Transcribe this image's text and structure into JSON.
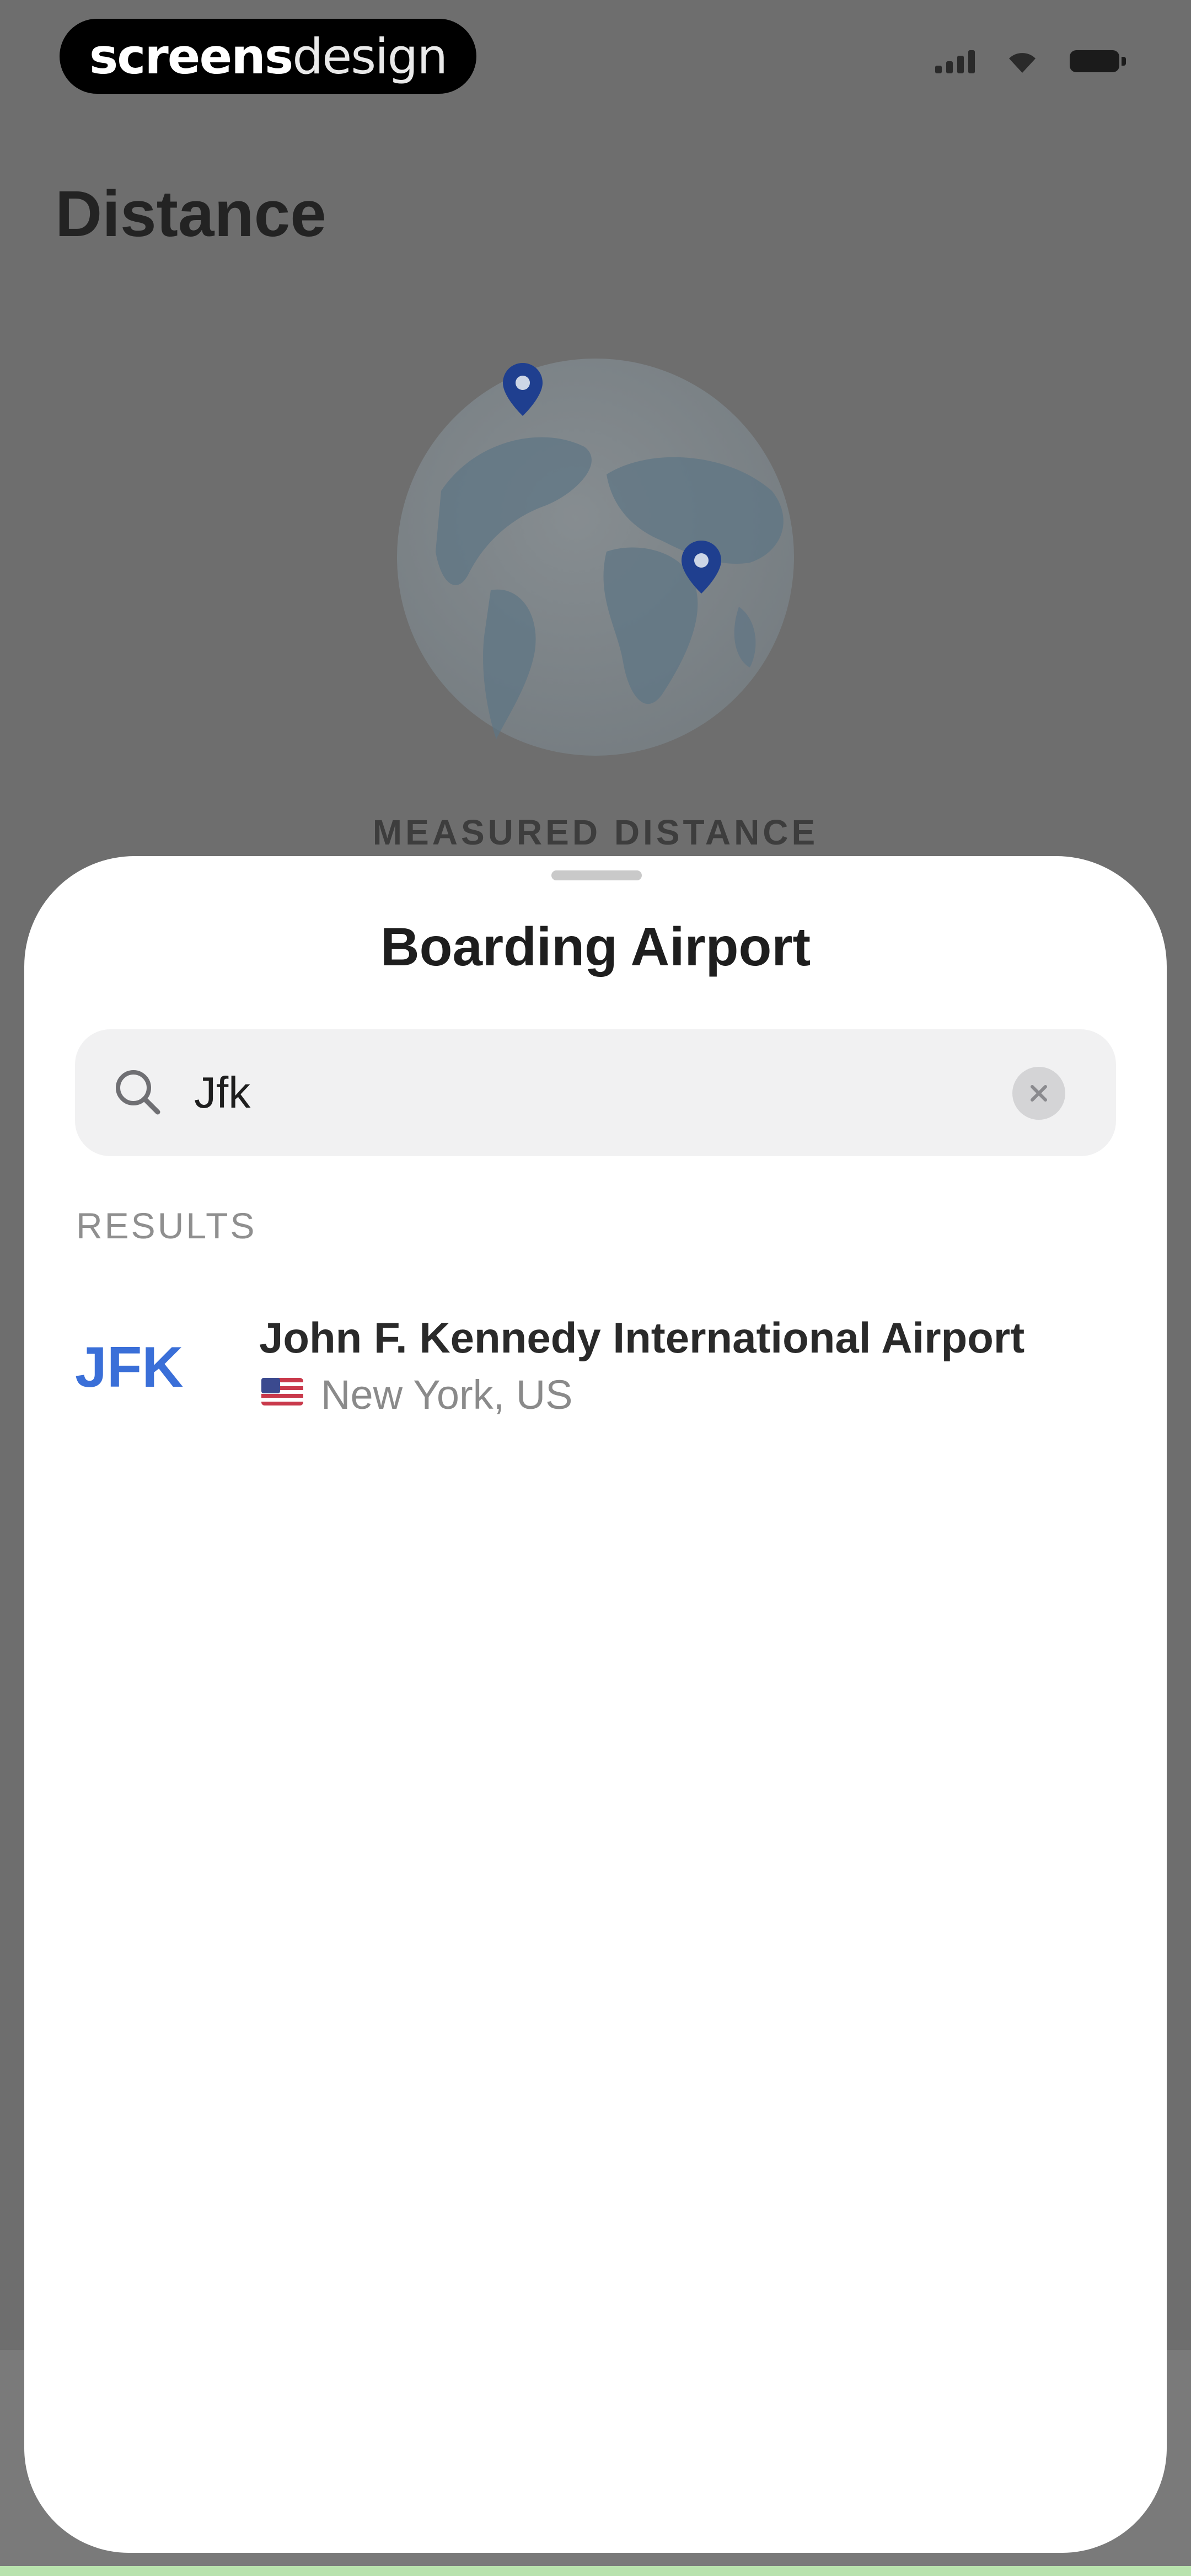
{
  "status_bar": {
    "brand_bold": "screens",
    "brand_light": "design",
    "icons": [
      "cellular-signal-icon",
      "wifi-icon",
      "battery-icon"
    ]
  },
  "background_page": {
    "title": "Distance",
    "measured_label": "MEASURED DISTANCE"
  },
  "sheet": {
    "title": "Boarding Airport",
    "search": {
      "value": "Jfk",
      "icon": "search-icon",
      "clear_icon": "clear-icon"
    },
    "results_label": "RESULTS",
    "results": [
      {
        "code": "JFK",
        "name": "John F. Kennedy International Airport",
        "flag": "us-flag-icon",
        "location": "New York, US"
      }
    ]
  },
  "colors": {
    "overlay": "#6e6e6e",
    "accent": "#3a6fd8",
    "pin": "#1f3f8f",
    "sheet": "#ffffff",
    "search_bg": "#f1f1f2"
  }
}
